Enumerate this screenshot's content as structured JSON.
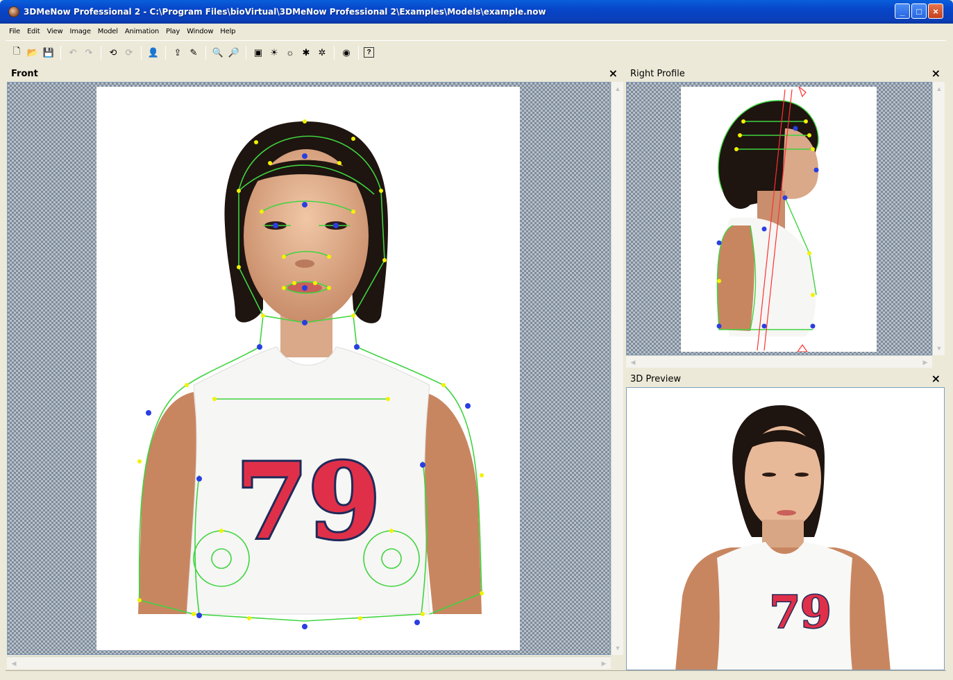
{
  "window": {
    "title": "3DMeNow Professional 2 - C:\\Program Files\\bioVirtual\\3DMeNow Professional 2\\Examples\\Models\\example.now",
    "minimize": "_",
    "maximize": "□",
    "close": "×"
  },
  "menu": [
    "File",
    "Edit",
    "View",
    "Image",
    "Model",
    "Animation",
    "Play",
    "Window",
    "Help"
  ],
  "toolbar": {
    "new": "🗋",
    "open": "📂",
    "save": "💾",
    "undo": "↶",
    "redo": "↷",
    "rotate_left": "⟲",
    "rotate_right": "⟳",
    "import_photo": "👤",
    "export": "⇪",
    "tool": "✎",
    "zoom_in": "🔍",
    "zoom_out": "🔎",
    "image": "▣",
    "light1": "☀",
    "light2": "☼",
    "light3": "✱",
    "light4": "✲",
    "globe": "◉",
    "help": "?"
  },
  "panels": {
    "front": {
      "title": "Front",
      "close": "×",
      "jersey_number": "79"
    },
    "right_profile": {
      "title": "Right Profile",
      "close": "×"
    },
    "preview": {
      "title": "3D Preview",
      "close": "×",
      "jersey_number": "79"
    }
  },
  "colors": {
    "mesh_line": "#3fd43f",
    "mesh_point": "#f2f200",
    "key_point": "#2a3fe0",
    "profile_guide": "#ff3030",
    "jersey_number": "#e03049"
  }
}
